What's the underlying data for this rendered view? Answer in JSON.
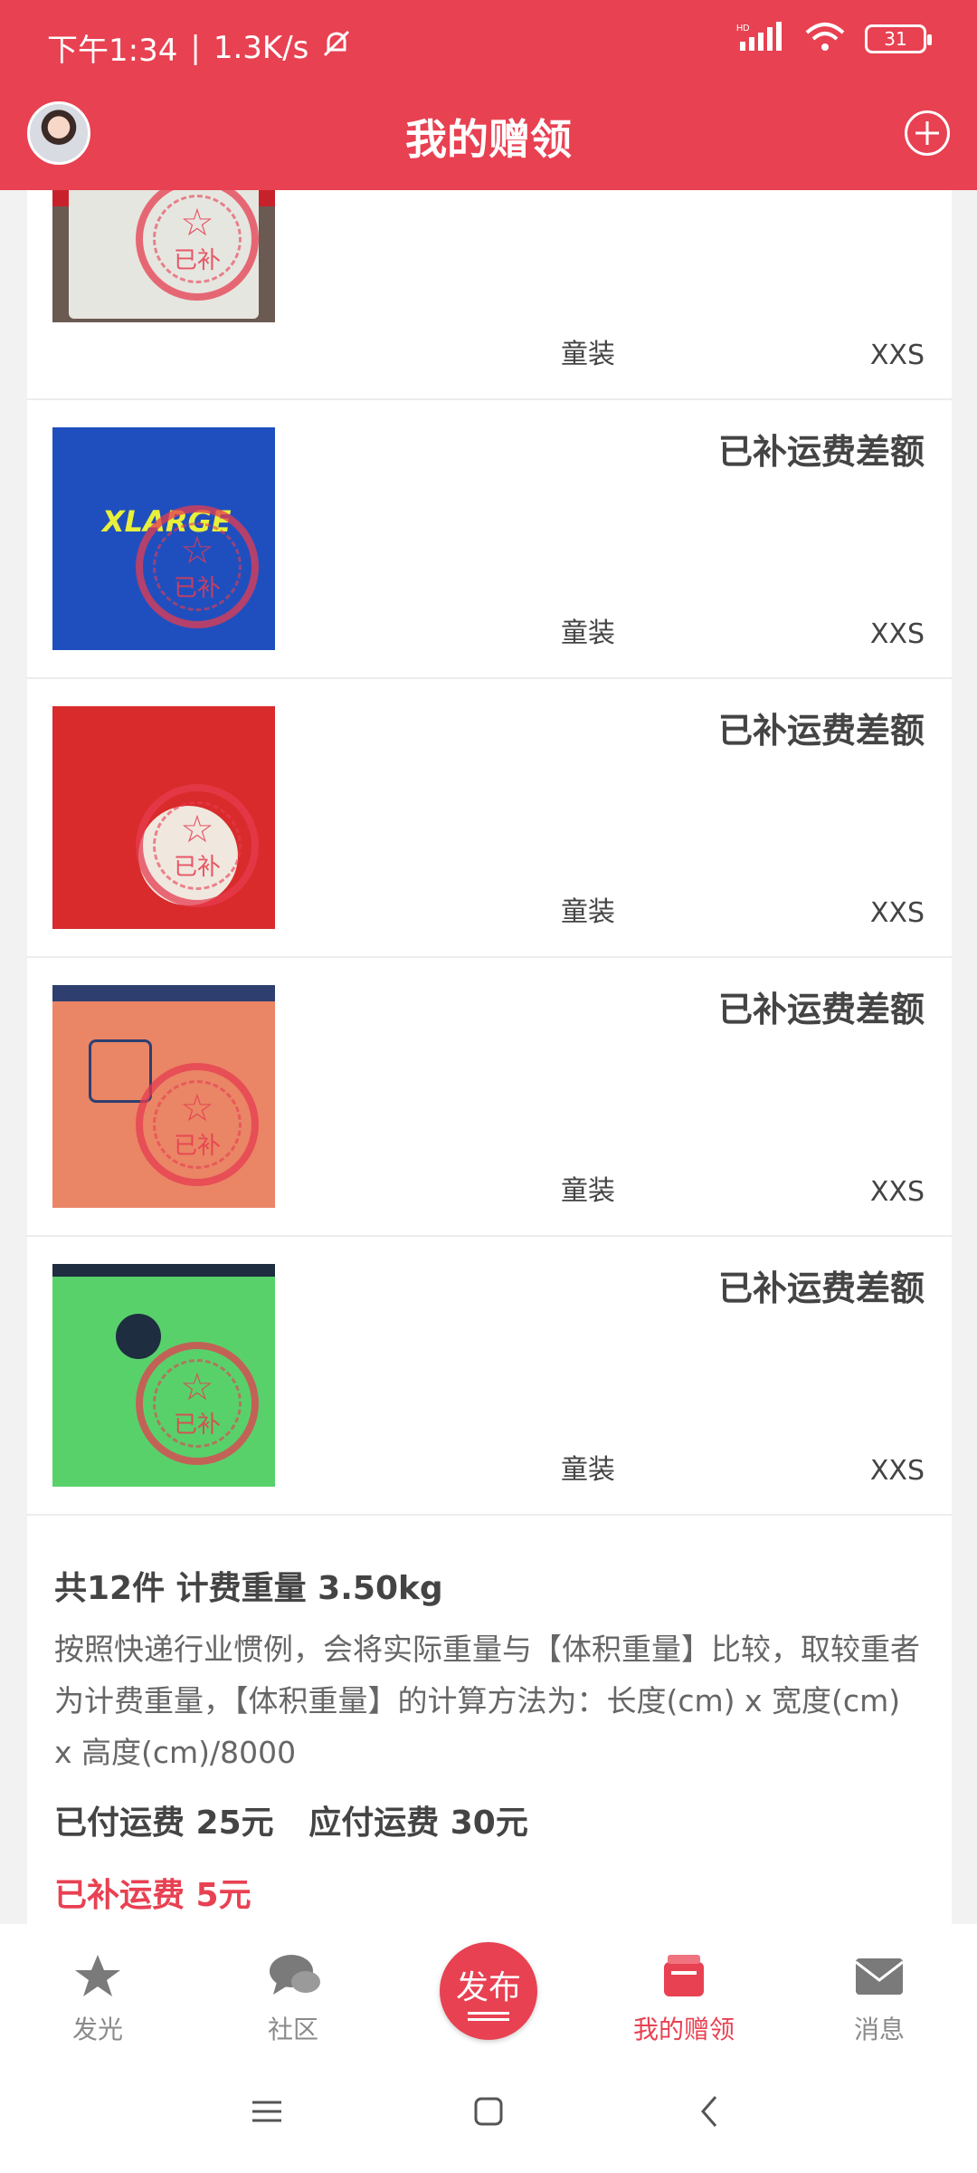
{
  "status_bar": {
    "time": "下午1:34",
    "separator": "|",
    "network_speed": "1.3K/s",
    "battery": "31",
    "hd_label": "HD"
  },
  "header": {
    "title": "我的赠领"
  },
  "items": [
    {
      "status": "",
      "category": "童装",
      "size": "XXS",
      "stamp_text": "已补",
      "shirt_color": "#e6e6e0"
    },
    {
      "status": "已补运费差额",
      "category": "童装",
      "size": "XXS",
      "stamp_text": "已补",
      "shirt_color": "#1f4fbf"
    },
    {
      "status": "已补运费差额",
      "category": "童装",
      "size": "XXS",
      "stamp_text": "已补",
      "shirt_color": "#d92b2b"
    },
    {
      "status": "已补运费差额",
      "category": "童装",
      "size": "XXS",
      "stamp_text": "已补",
      "shirt_color": "#ea8566"
    },
    {
      "status": "已补运费差额",
      "category": "童装",
      "size": "XXS",
      "stamp_text": "已补",
      "shirt_color": "#59d16b"
    }
  ],
  "summary": {
    "count_line": "共12件 计费重量 3.50kg",
    "explanation": "按照快递行业惯例，会将实际重量与【体积重量】比较，取较重者为计费重量，【体积重量】的计算方法为：长度(cm) x 宽度(cm) x 高度(cm)/8000",
    "paid": "已付运费 25元",
    "due": "应付运费 30元",
    "extra": "已补运费 5元"
  },
  "tabbar": {
    "tabs": [
      {
        "label": "发光",
        "icon": "star-icon",
        "active": false
      },
      {
        "label": "社区",
        "icon": "chat-icon",
        "active": false
      },
      {
        "label": "发布",
        "icon": "publish-icon",
        "active": false
      },
      {
        "label": "我的赠领",
        "icon": "gift-icon",
        "active": true
      },
      {
        "label": "消息",
        "icon": "mail-icon",
        "active": false
      }
    ]
  },
  "colors": {
    "brand": "#e84152",
    "text": "#444444",
    "muted": "#8a8a8a"
  }
}
